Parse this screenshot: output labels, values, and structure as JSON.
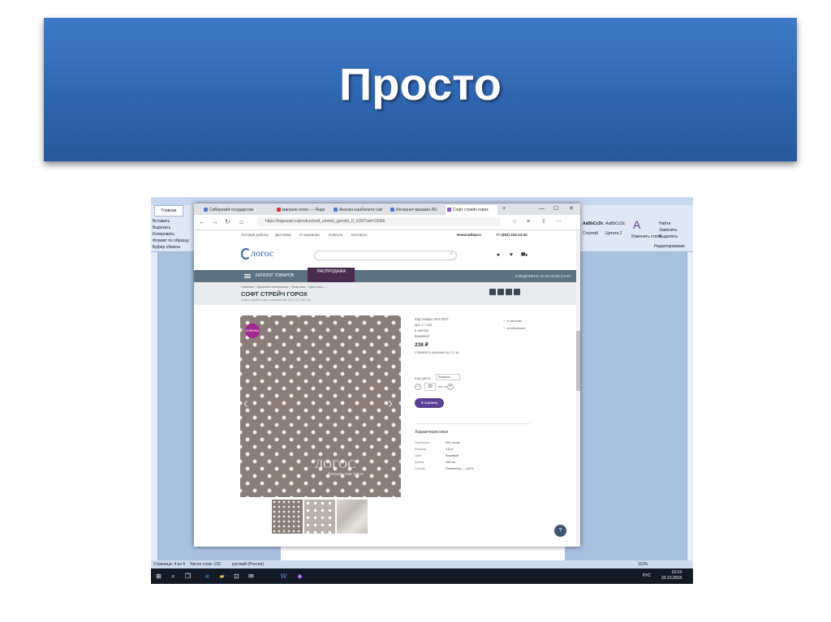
{
  "slide": {
    "title": "Просто"
  },
  "word": {
    "tab_home": "Главная",
    "left_labels": [
      "Вставить",
      "Вырезать",
      "Копировать",
      "Формат по образцу",
      "Буфер обмена"
    ],
    "style_sample_1": "AaBbCcDc",
    "style_sample_2": "AaBbCcDc",
    "style_big": "A",
    "style_name_1": "Строгий",
    "style_name_2": "Цитата 2",
    "change_styles": "Изменить стили",
    "find": "Найти",
    "replace": "Заменить",
    "select": "Выделить",
    "editing": "Редактирование",
    "status_page": "Страница: 4 из 4",
    "status_words": "Число слов: 133",
    "status_lang": "русский (Россия)",
    "zoom": "110%"
  },
  "taskbar": {
    "time": "10:19",
    "date": "20.10.2018",
    "lang": "РУС",
    "icons": [
      "windows-start-icon",
      "search-icon",
      "task-view-icon",
      "browser-icon",
      "explorer-icon",
      "store-icon",
      "mail-icon",
      "word-icon",
      "app-icon"
    ]
  },
  "browser": {
    "tabs": [
      "Сибирский государстве",
      "магазин логос — Янде",
      "Анализ юзабилити сай",
      "Интернет-магазин ЛО",
      "Софт стрейч горох"
    ],
    "url": "https://logosopt.ru/product/soft_stretch_gorokh_0_100/?oid=15966",
    "window_controls": [
      "—",
      "☐",
      "✕"
    ]
  },
  "site": {
    "top_links": [
      "Условия работы",
      "Доставка",
      "О компании",
      "Новости",
      "Контакты"
    ],
    "city": "Новосибирск",
    "phone": "+7 (383) 333-14-40",
    "logo": "логос",
    "catalog": "КАТАЛОГ ТОВАРОВ",
    "sale": "РАСПРОДАЖА",
    "hours": "ЕЖЕДНЕВНО 10.00-20.00 (НСК)",
    "breadcrumbs": "Главная › Одежные материалы › Трикотаж › Однотонн...",
    "product_title": "СОФТ СТРЕЙЧ ГОРОХ",
    "product_subtitle": "Софт стрейч горох ширина 84-150 170-180 см",
    "badge": "НОВИНКА",
    "watermark": "ЛОГОС",
    "watermark_sub": "больше, чем ткани",
    "code": "Код товара: 004-3237",
    "art": "арт. 2 / 150",
    "colors_count": "6 цветов",
    "color_name": "Бежевый",
    "price": "238 ₽",
    "price_note": "стоимость указана за 1 п. м.",
    "color_label": "Код цвета:",
    "color_value": "Бежевый",
    "qty": "20",
    "qty_unit": "пог. м",
    "cart_button": "В корзину",
    "side_link_1": "в наличии",
    "side_link_2": "в избранное",
    "characteristics_title": "Характеристики",
    "characteristics": [
      {
        "name": "Плотность",
        "value": "200 г/м кв."
      },
      {
        "name": "Ширина",
        "value": "1.8 м"
      },
      {
        "name": "Цвет",
        "value": "Бежевый"
      },
      {
        "name": "Длина",
        "value": "150 см"
      },
      {
        "name": "Состав",
        "value": "Полиэстер — 100%"
      }
    ]
  }
}
